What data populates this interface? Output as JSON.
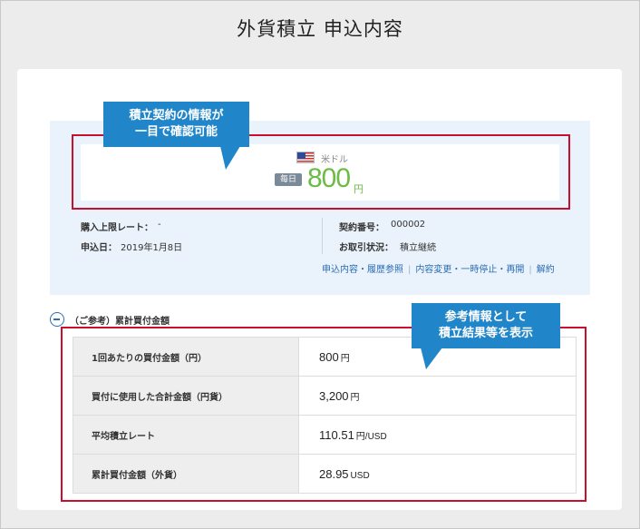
{
  "page": {
    "title": "外貨積立 申込内容"
  },
  "callouts": {
    "top": [
      "積立契約の情報が",
      "一目で確認可能"
    ],
    "bottom": [
      "参考情報として",
      "積立結果等を表示"
    ]
  },
  "summary": {
    "currency": "米ドル",
    "frequency_badge": "毎日",
    "amount": "800",
    "amount_unit": "円",
    "info": {
      "upper_rate_label": "購入上限レート：",
      "upper_rate_value": "-",
      "apply_date_label": "申込日：",
      "apply_date_value": "2019年1月8日",
      "contract_no_label": "契約番号：",
      "contract_no_value": "000002",
      "status_label": "お取引状況：",
      "status_value": "積立継続"
    },
    "links": {
      "history": "申込内容・履歴参照",
      "change": "内容変更・一時停止・再開",
      "cancel": "解約",
      "separator": "|"
    }
  },
  "reference": {
    "title": "（ご参考）累計買付金額",
    "rows": [
      {
        "label": "1回あたりの買付金額（円）",
        "value": "800",
        "unit": "円"
      },
      {
        "label": "買付に使用した合計金額（円貨）",
        "value": "3,200",
        "unit": "円"
      },
      {
        "label": "平均積立レート",
        "value": "110.51",
        "unit": "円/USD"
      },
      {
        "label": "累計買付金額（外貨）",
        "value": "28.95",
        "unit": "USD"
      }
    ]
  },
  "colors": {
    "accent_blue": "#2186c9",
    "highlight_red": "#c8102e",
    "amount_green": "#6cbb44",
    "link_blue": "#2a6cb5"
  }
}
